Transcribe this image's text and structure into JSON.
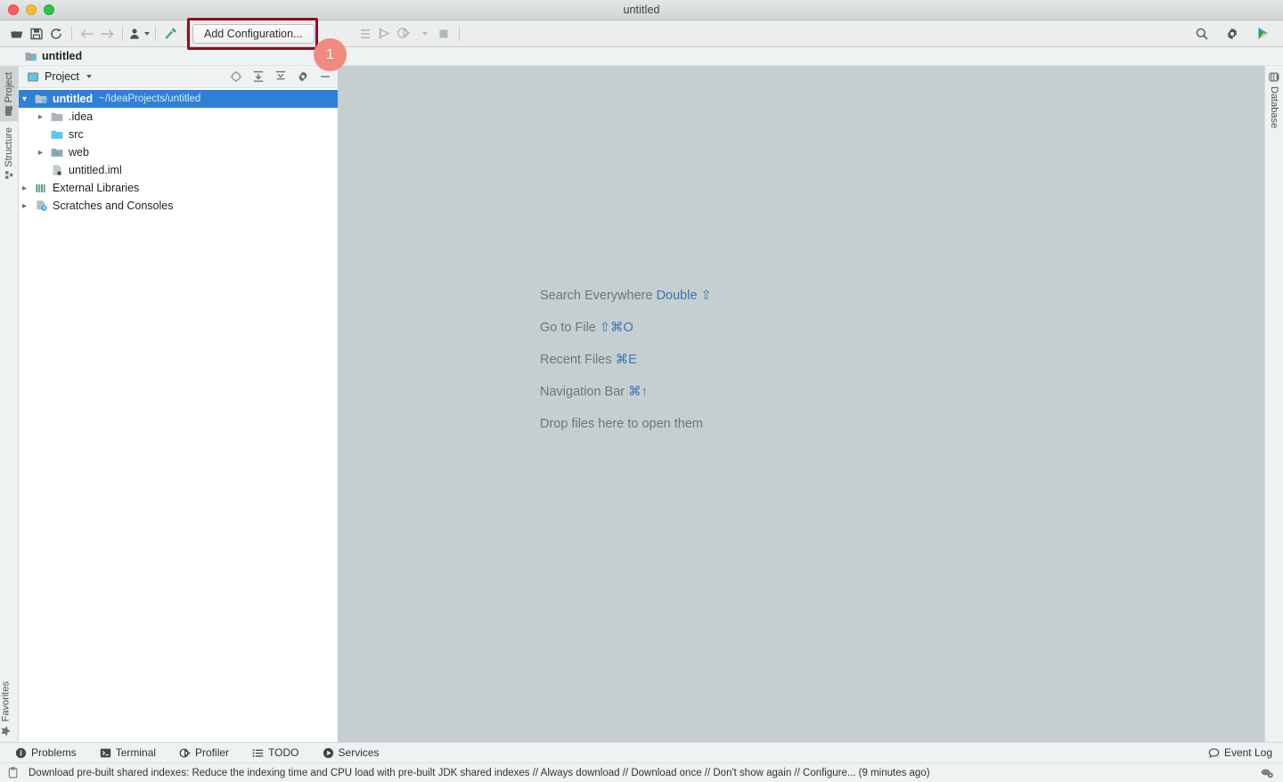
{
  "window": {
    "title": "untitled",
    "traffic_lights": [
      "close",
      "minimize",
      "zoom"
    ]
  },
  "toolbar": {
    "icons_left": [
      {
        "name": "open-folder-icon",
        "label": "Open"
      },
      {
        "name": "save-all-icon",
        "label": "Save All"
      },
      {
        "name": "sync-icon",
        "label": "Synchronize"
      },
      {
        "name": "back-arrow-icon",
        "label": "Back"
      },
      {
        "name": "forward-arrow-icon",
        "label": "Forward"
      },
      {
        "name": "vcs-user-icon",
        "label": "VCS operations"
      },
      {
        "name": "build-hammer-icon",
        "label": "Build Project"
      }
    ],
    "add_configuration_label": "Add Configuration...",
    "icons_right_group": [
      {
        "name": "run-icon",
        "label": "Run"
      },
      {
        "name": "debug-icon",
        "label": "Debug"
      },
      {
        "name": "run-dropdown-caret-icon",
        "label": "More"
      },
      {
        "name": "stop-icon",
        "label": "Stop"
      }
    ],
    "icons_far_right": [
      {
        "name": "search-icon",
        "label": "Search Everywhere"
      },
      {
        "name": "gear-icon",
        "label": "Settings"
      },
      {
        "name": "ide-play-icon",
        "label": "Updates"
      }
    ]
  },
  "annotation": {
    "badge_number": "1",
    "box_color": "#8b1020",
    "badge_color": "#f18b80"
  },
  "navbar": {
    "project_name": "untitled",
    "icon": "module-icon"
  },
  "left_stripe": {
    "top_tabs": [
      {
        "label": "Project",
        "icon": "project-folder-icon",
        "active": true
      },
      {
        "label": "Structure",
        "icon": "structure-icon",
        "active": false
      }
    ],
    "bottom_tabs": [
      {
        "label": "Favorites",
        "icon": "star-icon",
        "active": false
      }
    ]
  },
  "right_stripe": {
    "tabs": [
      {
        "label": "Database",
        "icon": "database-icon",
        "active": false
      }
    ]
  },
  "project_panel": {
    "header": {
      "title": "Project",
      "view_icon": "project-view-icon",
      "dropdown_icon": "chevron-down-icon",
      "actions": [
        {
          "name": "select-opened-file-icon",
          "label": "Select Opened File"
        },
        {
          "name": "expand-all-icon",
          "label": "Expand All"
        },
        {
          "name": "collapse-all-icon",
          "label": "Collapse All"
        },
        {
          "name": "gear-icon",
          "label": "Options"
        },
        {
          "name": "hide-icon",
          "label": "Hide"
        }
      ]
    },
    "tree": [
      {
        "depth": 0,
        "arrow": "down",
        "icon": "module-icon",
        "name": "untitled",
        "path": "~/IdeaProjects/untitled",
        "selected": true
      },
      {
        "depth": 1,
        "arrow": "right",
        "icon": "folder-icon",
        "name": ".idea",
        "path": "",
        "selected": false
      },
      {
        "depth": 1,
        "arrow": "none",
        "icon": "source-folder-icon",
        "name": "src",
        "path": "",
        "selected": false
      },
      {
        "depth": 1,
        "arrow": "right",
        "icon": "web-folder-icon",
        "name": "web",
        "path": "",
        "selected": false
      },
      {
        "depth": 1,
        "arrow": "none",
        "icon": "iml-file-icon",
        "name": "untitled.iml",
        "path": "",
        "selected": false
      },
      {
        "depth": 0,
        "arrow": "right",
        "icon": "libraries-icon",
        "name": "External Libraries",
        "path": "",
        "selected": false
      },
      {
        "depth": 0,
        "arrow": "right",
        "icon": "scratches-icon",
        "name": "Scratches and Consoles",
        "path": "",
        "selected": false
      }
    ]
  },
  "editor": {
    "hints": [
      {
        "label": "Search Everywhere",
        "shortcut": "Double ⇧"
      },
      {
        "label": "Go to File",
        "shortcut": "⇧⌘O"
      },
      {
        "label": "Recent Files",
        "shortcut": "⌘E"
      },
      {
        "label": "Navigation Bar",
        "shortcut": "⌘↑"
      },
      {
        "label": "Drop files here to open them",
        "shortcut": ""
      }
    ]
  },
  "bottom_bar": {
    "tabs": [
      {
        "label": "Problems",
        "icon": "problems-icon"
      },
      {
        "label": "Terminal",
        "icon": "terminal-icon"
      },
      {
        "label": "Profiler",
        "icon": "profiler-icon"
      },
      {
        "label": "TODO",
        "icon": "todo-list-icon"
      },
      {
        "label": "Services",
        "icon": "services-icon"
      }
    ],
    "right": {
      "label": "Event Log",
      "icon": "event-log-icon"
    }
  },
  "status_bar": {
    "icon": "notification-icon",
    "message": "Download pre-built shared indexes: Reduce the indexing time and CPU load with pre-built JDK shared indexes // Always download // Download once // Don't show again // Configure... (9 minutes ago)",
    "right_icon": "background-tasks-icon"
  },
  "colors": {
    "selection_blue": "#2f7fd6",
    "editor_bg": "#c6cfcf",
    "panel_bg": "#eef2f2",
    "link_blue": "#3a74b5",
    "folder_blue": "#7cc9e8"
  }
}
